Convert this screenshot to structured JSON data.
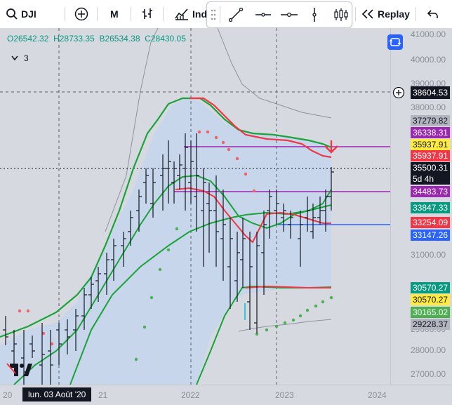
{
  "toolbar": {
    "symbol": "DJI",
    "interval": "M",
    "indicators_label": "Ind",
    "replay_label": "Replay"
  },
  "legend": {
    "open": "O26542.32",
    "high": "H28733.35",
    "low": "B26534.38",
    "close": "C28430.05",
    "collapsed_count": "3"
  },
  "price_axis": {
    "ticks": [
      "41000.00",
      "40000.00",
      "39000.00",
      "38000.00",
      "31000.00",
      "29000.00",
      "28000.00",
      "27000.00"
    ],
    "crosshair_price": "38604.53",
    "labels": [
      {
        "text": "37279.82",
        "bg": "#b2b5be",
        "fg": "#131722"
      },
      {
        "text": "36338.31",
        "bg": "#9c27b0",
        "fg": "#ffffff"
      },
      {
        "text": "35937.91",
        "bg": "#ffeb3b",
        "fg": "#131722"
      },
      {
        "text": "35937.91",
        "bg": "#f23645",
        "fg": "#ffffff"
      },
      {
        "text": "35500.31",
        "bg": "#131722",
        "fg": "#ffffff"
      },
      {
        "text": "5d 4h",
        "bg": "#131722",
        "fg": "#ffffff"
      },
      {
        "text": "34483.73",
        "bg": "#9c27b0",
        "fg": "#ffffff"
      },
      {
        "text": "33847.33",
        "bg": "#089981",
        "fg": "#ffffff"
      },
      {
        "text": "33254.09",
        "bg": "#f23645",
        "fg": "#ffffff"
      },
      {
        "text": "33147.26",
        "bg": "#2962ff",
        "fg": "#ffffff"
      },
      {
        "text": "30570.27",
        "bg": "#089981",
        "fg": "#ffffff"
      },
      {
        "text": "30570.27",
        "bg": "#ffeb3b",
        "fg": "#131722"
      },
      {
        "text": "30165.02",
        "bg": "#4caf50",
        "fg": "#ffffff"
      },
      {
        "text": "29228.37",
        "bg": "#b2b5be",
        "fg": "#131722"
      }
    ]
  },
  "time_axis": {
    "labels": [
      "20",
      "21",
      "2022",
      "2023",
      "2024"
    ],
    "crosshair_date": "lun. 03 Août '20"
  },
  "colors": {
    "accent": "#2962ff",
    "up_green": "#1aa33a",
    "down_red": "#f23645",
    "purple": "#9c27b0",
    "band_fill": "#c6d6ea"
  },
  "icons": [
    "search-icon",
    "add-circle-icon",
    "bar-style-icon",
    "indicators-icon",
    "drag-handle-icon",
    "trendline-icon",
    "horizontal-line-icon",
    "horizontal-ray-icon",
    "vertical-line-icon",
    "long-position-icon",
    "replay-icon",
    "undo-icon",
    "chevron-down-icon",
    "autofit-icon",
    "plus-circle-icon",
    "tradingview-logo-icon",
    "down-arrow-icon"
  ]
}
